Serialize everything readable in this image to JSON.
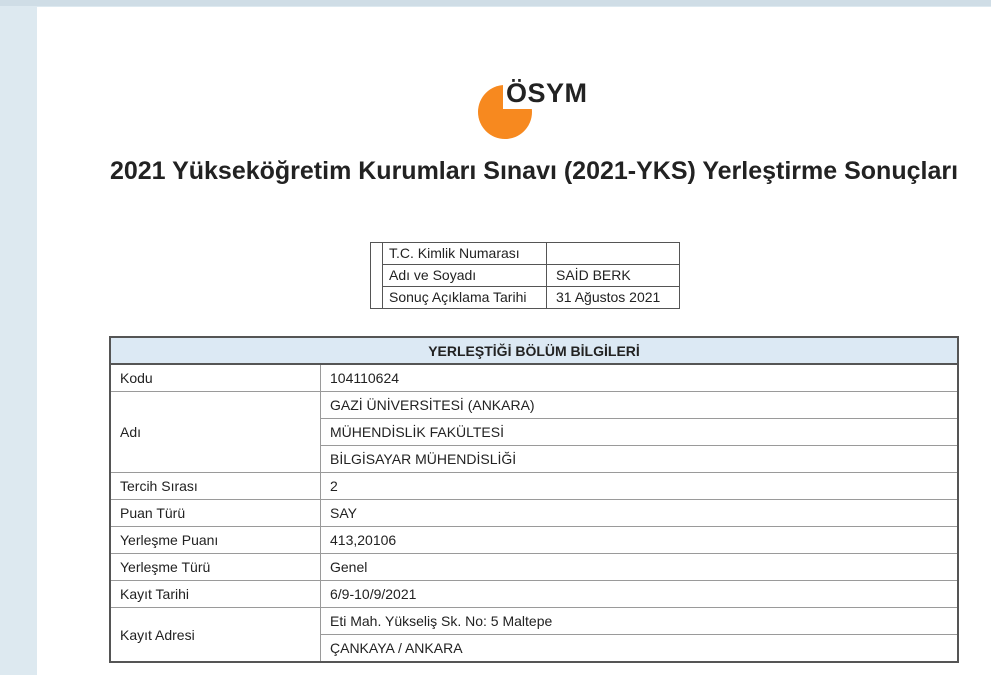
{
  "logo": {
    "text": "ÖSYM",
    "accent": "#f7891f"
  },
  "title": "2021 Yükseköğretim Kurumları Sınavı (2021-YKS) Yerleştirme Sonuçları",
  "info": {
    "tc_label": "T.C. Kimlik Numarası",
    "tc_value": "",
    "name_label": "Adı ve Soyadı",
    "name_value": "SAİD BERK",
    "date_label": "Sonuç Açıklama Tarihi",
    "date_value": "31 Ağustos 2021"
  },
  "placement": {
    "header": "YERLEŞTİĞİ BÖLÜM BİLGİLERİ",
    "code_label": "Kodu",
    "code_value": "104110624",
    "name_label": "Adı",
    "name_lines": [
      "GAZİ ÜNİVERSİTESİ (ANKARA)",
      "MÜHENDİSLİK FAKÜLTESİ",
      "BİLGİSAYAR MÜHENDİSLİĞİ"
    ],
    "preference_label": "Tercih Sırası",
    "preference_value": "2",
    "score_type_label": "Puan Türü",
    "score_type_value": "SAY",
    "score_label": "Yerleşme Puanı",
    "score_value": "413,20106",
    "type_label": "Yerleşme Türü",
    "type_value": "Genel",
    "reg_date_label": "Kayıt Tarihi",
    "reg_date_value": "6/9-10/9/2021",
    "address_label": "Kayıt Adresi",
    "address_lines": [
      "Eti Mah. Yükseliş Sk. No: 5 Maltepe",
      "ÇANKAYA / ANKARA"
    ]
  },
  "colors": {
    "header_bg": "#dce9f4",
    "page_bg": "#dde9f0"
  }
}
